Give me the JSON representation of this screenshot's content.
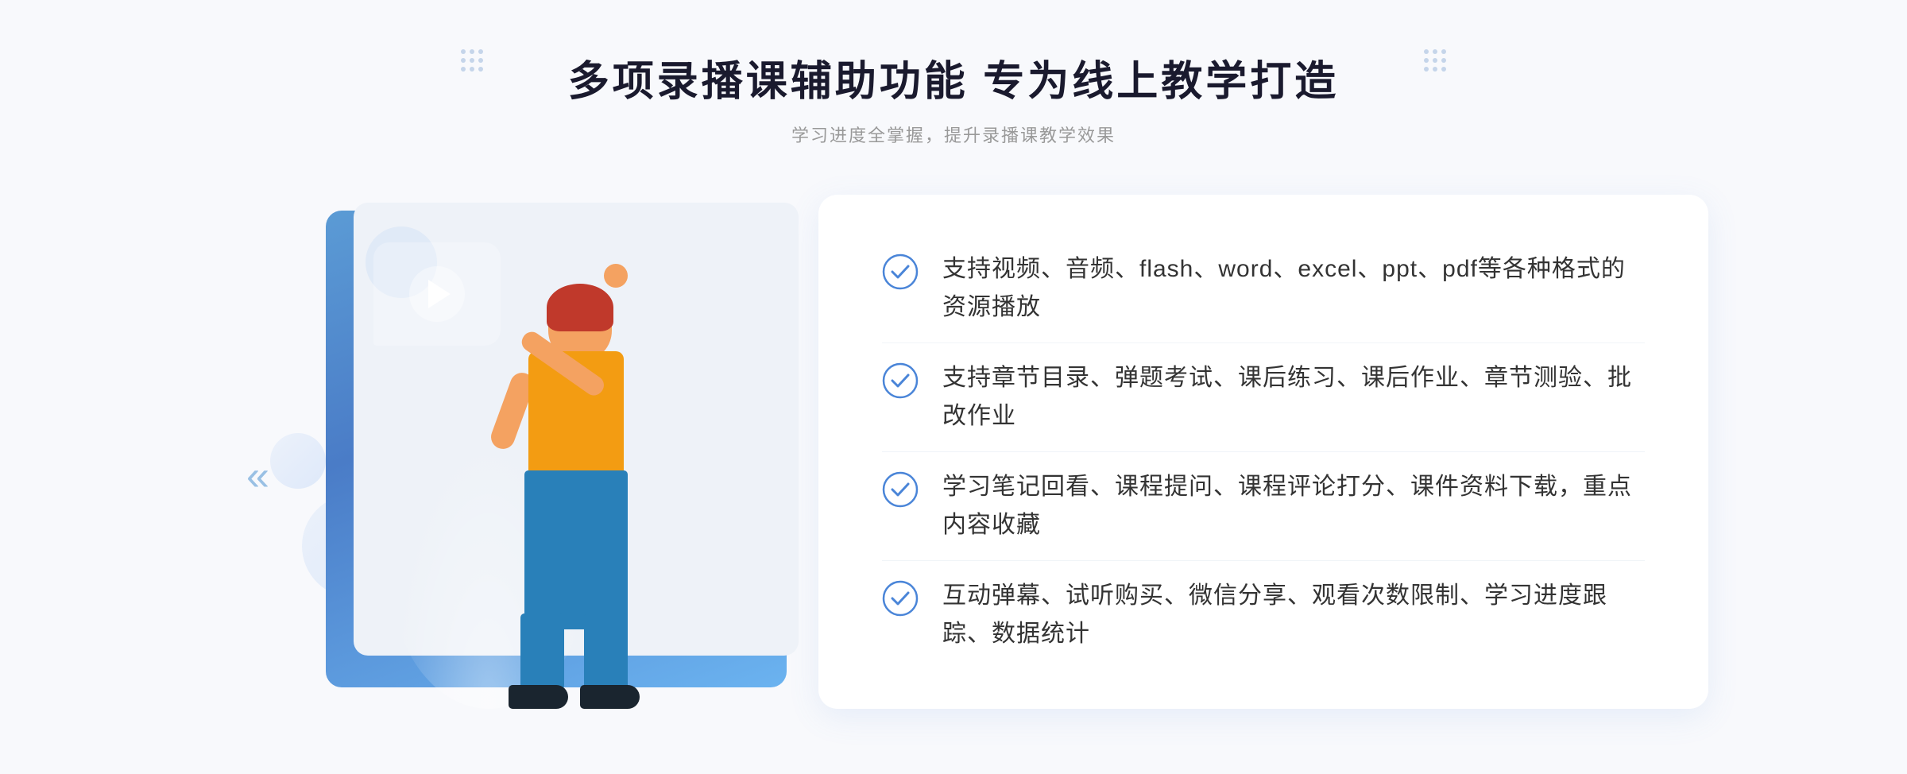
{
  "page": {
    "background_color": "#f8f9fc"
  },
  "header": {
    "main_title": "多项录播课辅助功能 专为线上教学打造",
    "sub_title": "学习进度全掌握，提升录播课教学效果"
  },
  "features": [
    {
      "id": "feature-1",
      "text": "支持视频、音频、flash、word、excel、ppt、pdf等各种格式的资源播放"
    },
    {
      "id": "feature-2",
      "text": "支持章节目录、弹题考试、课后练习、课后作业、章节测验、批改作业"
    },
    {
      "id": "feature-3",
      "text": "学习笔记回看、课程提问、课程评论打分、课件资料下载，重点内容收藏"
    },
    {
      "id": "feature-4",
      "text": "互动弹幕、试听购买、微信分享、观看次数限制、学习进度跟踪、数据统计"
    }
  ],
  "icons": {
    "check_circle": "check-circle-icon",
    "play": "play-icon",
    "chevron_left": "«"
  },
  "colors": {
    "accent_blue": "#4a85d8",
    "light_blue": "#7aaee8",
    "text_dark": "#333333",
    "text_gray": "#999999",
    "white": "#ffffff"
  }
}
